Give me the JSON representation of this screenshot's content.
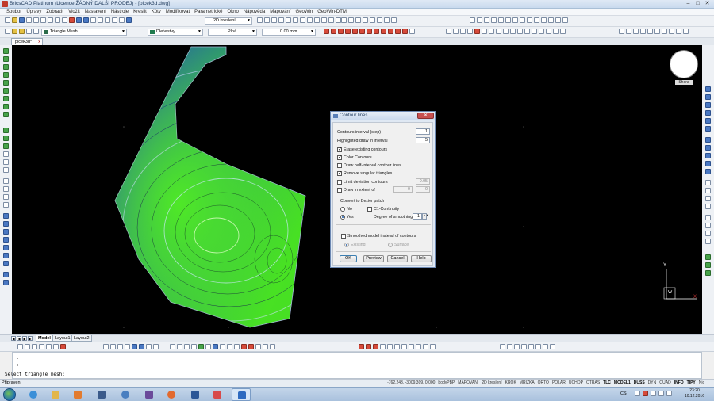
{
  "window": {
    "title": "BricsCAD Platinum (Licence ŽÁDNÝ DALŠÍ PRODEJ) - [picek3d.dwg]",
    "controls": [
      "–",
      "□",
      "✕"
    ]
  },
  "menu": [
    "Soubor",
    "Úpravy",
    "Zobrazit",
    "Vložit",
    "Nastavení",
    "Nástroje",
    "Kreslit",
    "Kóty",
    "Modifikovat",
    "Parametrické",
    "Okno",
    "Nápověda",
    "Mapování",
    "GeoWin",
    "GeoWin-DTM"
  ],
  "toolbar": {
    "view_combo": "2D kreslení",
    "layer_combo": "Triangle Mesh",
    "color_combo": "Dlelvrstvy",
    "linetype_combo": "Plná",
    "lineweight_combo": "0.00 mm"
  },
  "document_tab": {
    "label": "picek3d*",
    "close": "x"
  },
  "viewcube": {
    "label": "Shora"
  },
  "ucs": {
    "y": "Y",
    "x": "X",
    "w": "W"
  },
  "dialog": {
    "title": "Contour lines",
    "close": "✕",
    "contours_interval_label": "Contours interval (step)",
    "contours_interval_value": "1",
    "highlighted_label": "Highlighted draw in interval",
    "highlighted_value": "5",
    "erase_label": "Erase existing contours",
    "erase_checked": true,
    "color_label": "Color Contours",
    "color_checked": true,
    "half_interval_label": "Draw half-interval contour lines",
    "half_interval_checked": false,
    "remove_singular_label": "Remove singular triangles",
    "remove_singular_checked": true,
    "limit_deviation_label": "Limit deviation contours",
    "limit_deviation_checked": false,
    "limit_deviation_value": "0.05",
    "draw_extent_label": "Draw in extent of",
    "draw_extent_checked": false,
    "extent_from": "0",
    "extent_to": "0",
    "bezier_heading": "Convert to Bezier patch",
    "bezier_no": "No",
    "bezier_yes": "Yes",
    "bezier_selected": "Yes",
    "c1_label": "C1-Continuity",
    "c1_checked": false,
    "smoothing_label": "Degree of smoothing",
    "smoothing_value": "1",
    "smoothed_model_label": "Smoothed model instead of contours",
    "smoothed_model_checked": false,
    "model_existing": "Existing",
    "model_surface": "Surface",
    "buttons": {
      "ok": "OK",
      "preview": "Preview",
      "cancel": "Cancel",
      "help": "Help"
    }
  },
  "layout_tabs": [
    "Model",
    "Layout1",
    "Layout2"
  ],
  "command_line": {
    "history": [
      ":",
      ":"
    ],
    "prompt": "Select triangle mesh:"
  },
  "status": {
    "ready": "Připraven",
    "coords": "-762.243, -3009.309, 0.000",
    "items": [
      "bodyPBP",
      "MAPOVANI",
      "2D kreslení",
      "KROK",
      "MŘÍŽKA",
      "ORTO",
      "POLAR",
      "UCHOP",
      "OTRAS",
      "TLČ",
      "MODEL1",
      "DUSS",
      "DYN",
      "QUAD",
      "INFO",
      "TIPY",
      "Nic"
    ]
  },
  "taskbar": {
    "time": "23:20",
    "date": "10.12.2016",
    "lang": "CS"
  },
  "colors": {
    "mesh_low": "#1a2fd6",
    "mesh_mid": "#2f9c6a",
    "mesh_high": "#47e023",
    "canvas": "#000000"
  }
}
